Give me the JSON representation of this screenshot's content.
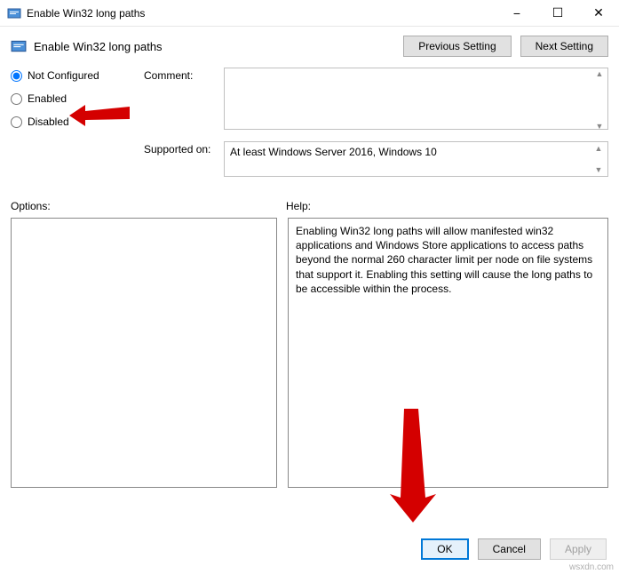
{
  "titlebar": {
    "title": "Enable Win32 long paths"
  },
  "header": {
    "title": "Enable Win32 long paths",
    "buttons": {
      "previous": "Previous Setting",
      "next": "Next Setting"
    }
  },
  "radios": {
    "not_configured": "Not Configured",
    "enabled": "Enabled",
    "disabled": "Disabled",
    "selected": "not_configured"
  },
  "labels": {
    "comment": "Comment:",
    "supported_on": "Supported on:",
    "options": "Options:",
    "help": "Help:"
  },
  "fields": {
    "comment": "",
    "supported_on": "At least Windows Server 2016, Windows 10"
  },
  "help_text": "Enabling Win32 long paths will allow manifested win32 applications and Windows Store applications to access paths beyond the normal 260 character limit per node on file systems that support it.  Enabling this setting will cause the long paths to be accessible within the process.",
  "footer": {
    "ok": "OK",
    "cancel": "Cancel",
    "apply": "Apply"
  },
  "watermark": "wsxdn.com"
}
